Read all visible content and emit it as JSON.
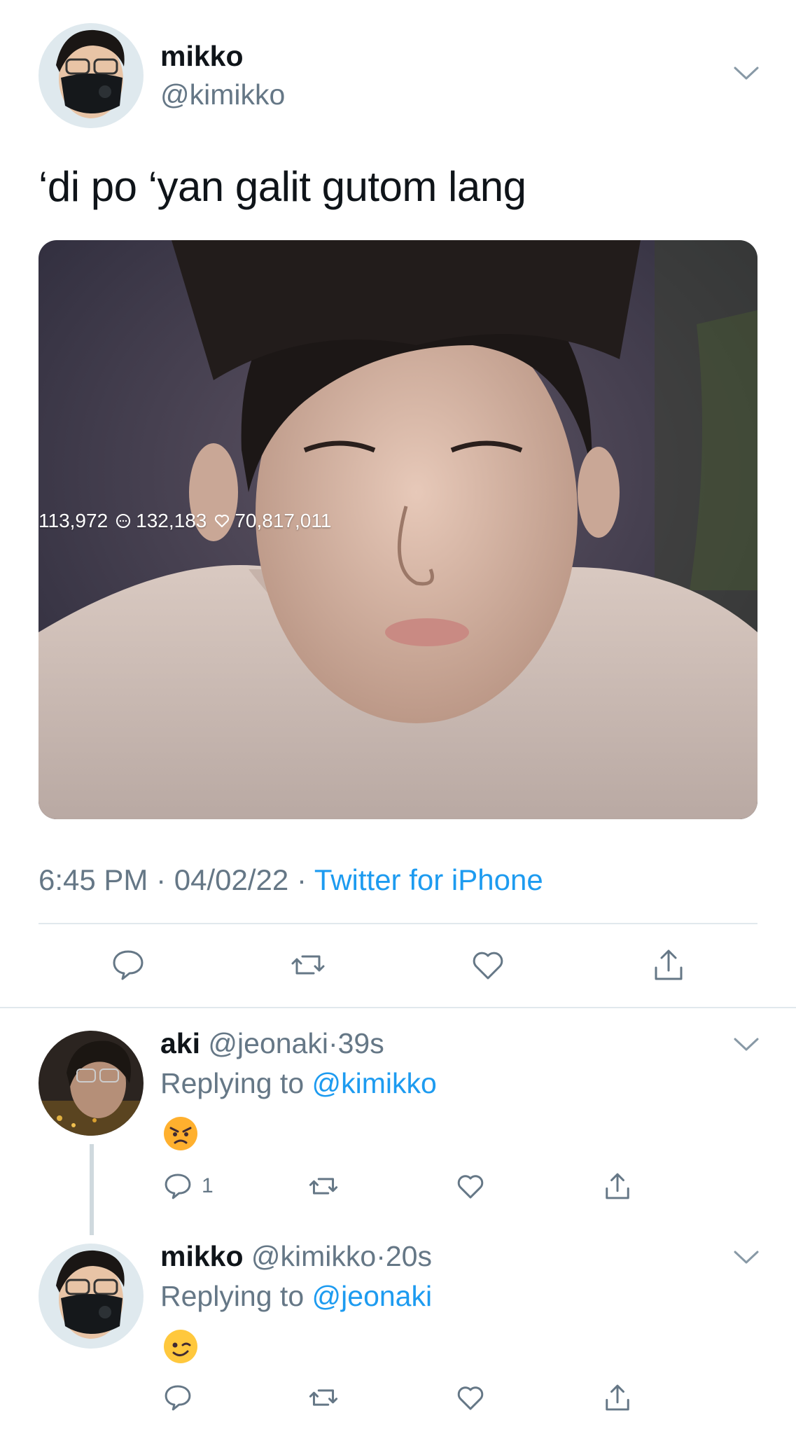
{
  "main_tweet": {
    "name": "mikko",
    "handle": "@kimikko",
    "text": "‘di po ‘yan galit gutom lang",
    "media_stats": {
      "retweets": "113,972",
      "comments": "132,183",
      "likes": "70,817,011"
    },
    "time": "6:45 PM",
    "date": "04/02/22",
    "separator": "·",
    "client": "Twitter for iPhone"
  },
  "replies": [
    {
      "name": "aki",
      "handle": "@jeonaki",
      "time": "39s",
      "replying_prefix": "Replying to",
      "replying_to": "@kimikko",
      "emoji": "angry-face",
      "reply_count": "1"
    },
    {
      "name": "mikko",
      "handle": "@kimikko",
      "time": "20s",
      "replying_prefix": "Replying to",
      "replying_to": "@jeonaki",
      "emoji": "winking-face"
    }
  ],
  "icons": [
    "chevron-down-icon",
    "reply-icon",
    "retweet-icon",
    "like-icon",
    "share-icon"
  ],
  "colors": {
    "accent": "#1d9bf0",
    "muted": "#657786",
    "divider": "#e1e8ed"
  }
}
